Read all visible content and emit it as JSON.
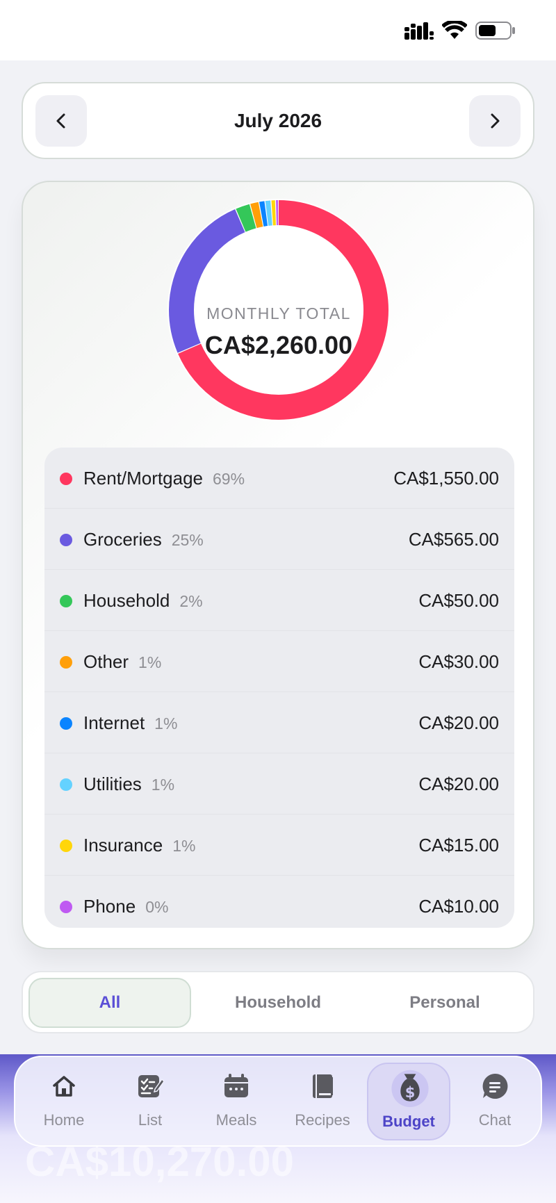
{
  "header": {
    "month": "July 2026"
  },
  "summary": {
    "label": "MONTHLY TOTAL",
    "total": "CA$2,260.00"
  },
  "chart_data": {
    "type": "pie",
    "title": "",
    "categories": [
      "Rent/Mortgage",
      "Groceries",
      "Household",
      "Other",
      "Internet",
      "Utilities",
      "Insurance",
      "Phone"
    ],
    "values": [
      1550,
      565,
      50,
      30,
      20,
      20,
      15,
      10
    ],
    "colors": [
      "#ff375f",
      "#6a5ae0",
      "#34c759",
      "#ff9f0a",
      "#0a84ff",
      "#64d2ff",
      "#ffd60a",
      "#bf5af2"
    ]
  },
  "categories": [
    {
      "name": "Rent/Mortgage",
      "pct": "69%",
      "amount": "CA$1,550.00",
      "color": "#ff375f"
    },
    {
      "name": "Groceries",
      "pct": "25%",
      "amount": "CA$565.00",
      "color": "#6a5ae0"
    },
    {
      "name": "Household",
      "pct": "2%",
      "amount": "CA$50.00",
      "color": "#34c759"
    },
    {
      "name": "Other",
      "pct": "1%",
      "amount": "CA$30.00",
      "color": "#ff9f0a"
    },
    {
      "name": "Internet",
      "pct": "1%",
      "amount": "CA$20.00",
      "color": "#0a84ff"
    },
    {
      "name": "Utilities",
      "pct": "1%",
      "amount": "CA$20.00",
      "color": "#64d2ff"
    },
    {
      "name": "Insurance",
      "pct": "1%",
      "amount": "CA$15.00",
      "color": "#ffd60a"
    },
    {
      "name": "Phone",
      "pct": "0%",
      "amount": "CA$10.00",
      "color": "#bf5af2"
    }
  ],
  "filters": {
    "all": "All",
    "household": "Household",
    "personal": "Personal",
    "selected": "All"
  },
  "tabs": [
    {
      "label": "Home",
      "icon": "home-icon"
    },
    {
      "label": "List",
      "icon": "list-icon"
    },
    {
      "label": "Meals",
      "icon": "calendar-icon"
    },
    {
      "label": "Recipes",
      "icon": "book-icon"
    },
    {
      "label": "Budget",
      "icon": "money-bag-icon",
      "active": true
    },
    {
      "label": "Chat",
      "icon": "chat-icon"
    }
  ],
  "background": {
    "ghost_total": "CA$10,270.00"
  },
  "colors": {
    "accent": "#5b4fd6",
    "card_border": "#d6dcd8"
  }
}
